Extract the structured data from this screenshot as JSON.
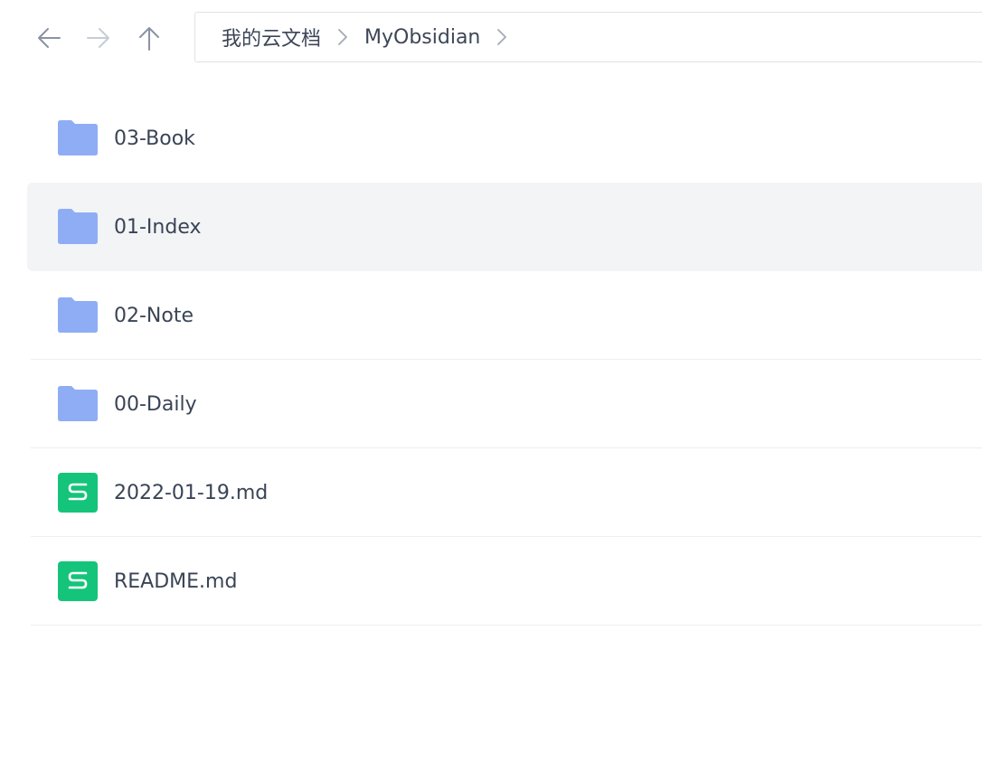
{
  "toolbar": {
    "back_icon": "arrow-left-icon",
    "forward_icon": "arrow-right-icon",
    "up_icon": "arrow-up-icon"
  },
  "breadcrumb": {
    "items": [
      "我的云文档",
      "MyObsidian"
    ],
    "separator_icon": "chevron-right-icon"
  },
  "files": [
    {
      "name": "03-Book",
      "type": "folder",
      "icon": "folder-icon"
    },
    {
      "name": "01-Index",
      "type": "folder",
      "icon": "folder-icon",
      "selected": true
    },
    {
      "name": "02-Note",
      "type": "folder",
      "icon": "folder-icon"
    },
    {
      "name": "00-Daily",
      "type": "folder",
      "icon": "folder-icon"
    },
    {
      "name": "2022-01-19.md",
      "type": "markdown",
      "icon": "markdown-file-icon"
    },
    {
      "name": "README.md",
      "type": "markdown",
      "icon": "markdown-file-icon"
    }
  ],
  "colors": {
    "folder": "#8fadf4",
    "markdown": "#14c47a",
    "selected_row": "#f3f4f6",
    "nav_active": "#8a93a3",
    "nav_disabled": "#c6ccd6"
  }
}
